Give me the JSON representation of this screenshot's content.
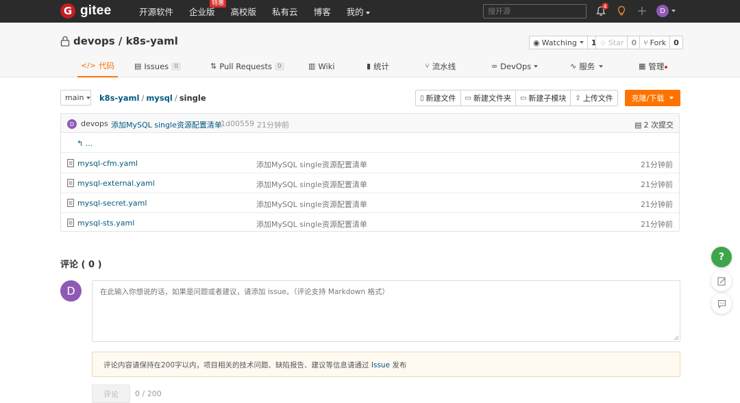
{
  "topnav": {
    "logo_mark": "G",
    "logo_text": "gitee",
    "items": [
      {
        "label": "开源软件"
      },
      {
        "label": "企业版",
        "badge": "特惠"
      },
      {
        "label": "高校版"
      },
      {
        "label": "私有云"
      },
      {
        "label": "博客"
      },
      {
        "label": "我的"
      }
    ],
    "search_placeholder": "搜开源",
    "notification_count": "4",
    "avatar_initial": "D",
    "icons": [
      "bell-icon",
      "lightbulb-icon",
      "plus-icon"
    ]
  },
  "repo": {
    "title": "devops / k8s-yaml",
    "watch": {
      "label": "Watching",
      "count": "1"
    },
    "star": {
      "label": "Star",
      "count": "0"
    },
    "fork": {
      "label": "Fork",
      "count": "0"
    }
  },
  "tabs": [
    {
      "icon": "</>",
      "label": "代码",
      "active": true
    },
    {
      "icon": "▤",
      "label": "Issues",
      "count": "0"
    },
    {
      "icon": "⇅",
      "label": "Pull Requests",
      "count": "0"
    },
    {
      "icon": "▥",
      "label": "Wiki"
    },
    {
      "icon": "▮",
      "label": "统计"
    },
    {
      "icon": "⑂",
      "label": "流水线"
    },
    {
      "icon": "∞",
      "label": "DevOps"
    },
    {
      "icon": "∿",
      "label": "服务"
    },
    {
      "icon": "▦",
      "label": "管理"
    }
  ],
  "toolbar": {
    "branch": "main",
    "breadcrumb": [
      "k8s-yaml",
      "mysql",
      "single"
    ],
    "buttons": [
      "新建文件",
      "新建文件夹",
      "新建子模块",
      "上传文件"
    ],
    "clone_label": "克隆/下载"
  },
  "commit": {
    "avatar_initial": "D",
    "author": "devops",
    "message": "添加MySQL single资源配置清单",
    "sha": "1d00559",
    "time": "21分钟前",
    "count_label": "2 次提交"
  },
  "back_link": "...",
  "files": [
    {
      "name": "mysql-cfm.yaml",
      "message": "添加MySQL single资源配置清单",
      "time": "21分钟前"
    },
    {
      "name": "mysql-external.yaml",
      "message": "添加MySQL single资源配置清单",
      "time": "21分钟前"
    },
    {
      "name": "mysql-secret.yaml",
      "message": "添加MySQL single资源配置清单",
      "time": "21分钟前"
    },
    {
      "name": "mysql-sts.yaml",
      "message": "添加MySQL single资源配置清单",
      "time": "21分钟前"
    }
  ],
  "comments": {
    "title": "评论 ( 0 )",
    "avatar_initial": "D",
    "placeholder": "在此输入你想说的话，如果是问题或者建议，请添加 issue。（评论支持 Markdown 格式）",
    "notice_before": "评论内容请保持在200字以内，项目相关的技术问题、缺陷报告、建议等信息请通过 ",
    "notice_link": "Issue",
    "notice_after": " 发布",
    "submit_label": "评论",
    "char_count": "0 / 200"
  },
  "floating": {
    "help_label": "?"
  },
  "colors": {
    "accent": "#fe7300",
    "link": "#005980",
    "topbar": "#2b2b2b",
    "help": "#3ea54a"
  }
}
